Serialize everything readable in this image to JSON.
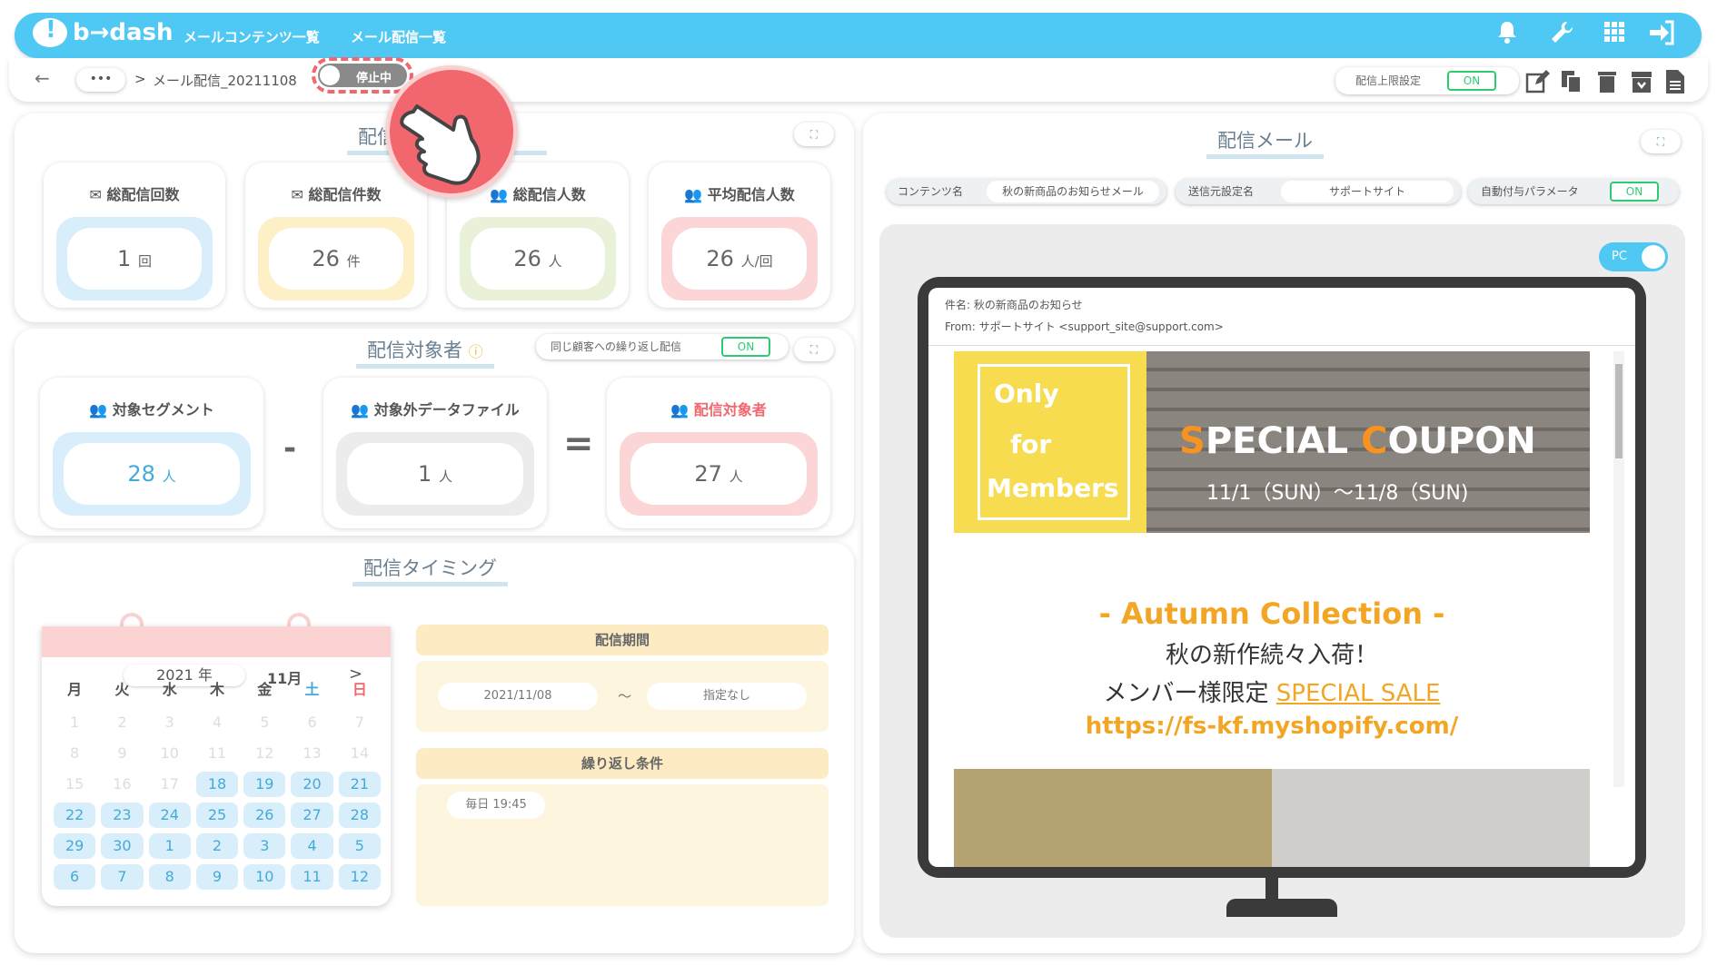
{
  "header": {
    "logo": "b→dash",
    "nav": [
      "メールコンテンツ一覧",
      "メール配信一覧"
    ],
    "icons": [
      "bell-icon",
      "wrench-icon",
      "grid-icon",
      "logout-icon"
    ]
  },
  "breadcrumb": {
    "back": "←",
    "more": "•••",
    "separator": ">",
    "current": "メール配信_20211108",
    "status": "停止中",
    "limit_label": "配信上限設定",
    "limit_toggle": "ON"
  },
  "stats": {
    "title": "配信",
    "cards": [
      {
        "label": "総配信回数",
        "value": "1",
        "unit": "回"
      },
      {
        "label": "総配信件数",
        "value": "26",
        "unit": "件"
      },
      {
        "label": "総配信人数",
        "value": "26",
        "unit": "人"
      },
      {
        "label": "平均配信人数",
        "value": "26",
        "unit": "人/回"
      }
    ]
  },
  "target": {
    "title": "配信対象者",
    "repeat_label": "同じ顧客への繰り返し配信",
    "repeat_toggle": "ON",
    "cards": [
      {
        "label": "対象セグメント",
        "value": "28",
        "unit": "人"
      },
      {
        "label": "対象外データファイル",
        "value": "1",
        "unit": "人"
      },
      {
        "label": "配信対象者",
        "value": "27",
        "unit": "人"
      }
    ],
    "minus": "-",
    "equals": "="
  },
  "timing": {
    "title": "配信タイミング",
    "year": "2021 年",
    "month": "11月",
    "next": ">",
    "weekdays": [
      "月",
      "火",
      "水",
      "木",
      "金",
      "土",
      "日"
    ],
    "days": [
      [
        "1",
        "dis"
      ],
      [
        "2",
        "dis"
      ],
      [
        "3",
        "dis"
      ],
      [
        "4",
        "dis"
      ],
      [
        "5",
        "dis"
      ],
      [
        "6",
        "dis"
      ],
      [
        "7",
        "dis"
      ],
      [
        "8",
        "dis"
      ],
      [
        "9",
        "dis"
      ],
      [
        "10",
        "dis"
      ],
      [
        "11",
        "dis"
      ],
      [
        "12",
        "dis"
      ],
      [
        "13",
        "dis"
      ],
      [
        "14",
        "dis"
      ],
      [
        "15",
        "dis"
      ],
      [
        "16",
        "dis"
      ],
      [
        "17",
        "dis"
      ],
      [
        "18",
        "act"
      ],
      [
        "19",
        "act"
      ],
      [
        "20",
        "act"
      ],
      [
        "21",
        "act"
      ],
      [
        "22",
        "act"
      ],
      [
        "23",
        "act"
      ],
      [
        "24",
        "act"
      ],
      [
        "25",
        "act"
      ],
      [
        "26",
        "act"
      ],
      [
        "27",
        "act"
      ],
      [
        "28",
        "act"
      ],
      [
        "29",
        "act"
      ],
      [
        "30",
        "act"
      ],
      [
        "1",
        "act"
      ],
      [
        "2",
        "act"
      ],
      [
        "3",
        "act"
      ],
      [
        "4",
        "act"
      ],
      [
        "5",
        "act"
      ],
      [
        "6",
        "act"
      ],
      [
        "7",
        "act"
      ],
      [
        "8",
        "act"
      ],
      [
        "9",
        "act"
      ],
      [
        "10",
        "act"
      ],
      [
        "11",
        "act"
      ],
      [
        "12",
        "act"
      ]
    ],
    "period_label": "配信期間",
    "period_start": "2021/11/08",
    "period_sep": "〜",
    "period_end": "指定なし",
    "repeat_label": "繰り返し条件",
    "repeat_value": "毎日 19:45"
  },
  "mail": {
    "title": "配信メール",
    "content_label": "コンテンツ名",
    "content_value": "秋の新商品のお知らせメール",
    "sender_label": "送信元設定名",
    "sender_value": "サポートサイト",
    "param_label": "自動付与パラメータ",
    "param_toggle": "ON",
    "view_toggle": "PC",
    "subject": "件名: 秋の新商品のお知らせ",
    "from": "From: サポートサイト <support_site@support.com>",
    "banner_left": [
      "Only",
      "for",
      "Members"
    ],
    "banner_s": "S",
    "banner_pecial": "PECIAL",
    "banner_c": "C",
    "banner_oupon": "OUPON",
    "banner_date": "11/1（SUN）～11/8（SUN)",
    "collection": "- Autumn Collection -",
    "line1": "秋の新作続々入荷！",
    "line2_prefix": "メンバー様限定 ",
    "line2_link": "SPECIAL SALE",
    "url": "https://fs-kf.myshopify.com/"
  }
}
